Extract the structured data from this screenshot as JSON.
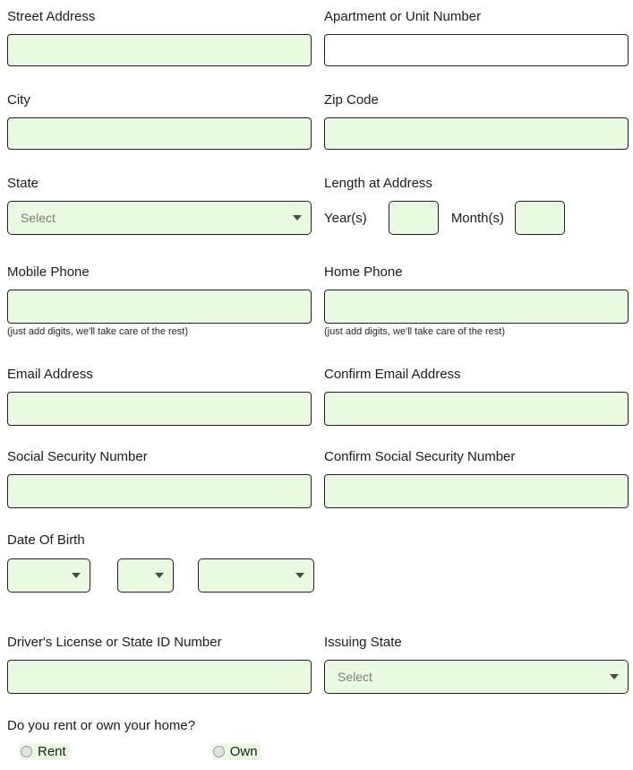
{
  "form": {
    "fields": {
      "street_address": {
        "label": "Street Address",
        "value": "",
        "required": true
      },
      "apartment": {
        "label": "Apartment or Unit Number",
        "value": "",
        "required": false
      },
      "city": {
        "label": "City",
        "value": "",
        "required": true
      },
      "zip_code": {
        "label": "Zip Code",
        "value": "",
        "required": true
      },
      "state": {
        "label": "State",
        "placeholder": "Select",
        "value": ""
      },
      "length_at_address": {
        "label": "Length at Address",
        "years_label": "Year(s)",
        "years_value": "",
        "months_label": "Month(s)",
        "months_value": ""
      },
      "mobile_phone": {
        "label": "Mobile Phone",
        "value": "",
        "helper": "(just add digits, we'll take care of the rest)"
      },
      "home_phone": {
        "label": "Home Phone",
        "value": "",
        "helper": "(just add digits, we'll take care of the rest)"
      },
      "email": {
        "label": "Email Address",
        "value": ""
      },
      "confirm_email": {
        "label": "Confirm Email Address",
        "value": ""
      },
      "ssn": {
        "label": "Social Security Number",
        "value": ""
      },
      "confirm_ssn": {
        "label": "Confirm Social Security Number",
        "value": ""
      },
      "date_of_birth": {
        "label": "Date Of Birth",
        "month_value": "",
        "day_value": "",
        "year_value": ""
      },
      "drivers_license": {
        "label": "Driver's License or State ID Number",
        "value": ""
      },
      "issuing_state": {
        "label": "Issuing State",
        "placeholder": "Select",
        "value": ""
      },
      "home_ownership": {
        "label": "Do you rent or own your home?",
        "options": [
          {
            "label": "Rent",
            "selected": false
          },
          {
            "label": "Own",
            "selected": false
          }
        ]
      }
    },
    "colors": {
      "required_field_bg": "#eafae1",
      "optional_field_bg": "#ffffff",
      "border": "#222222",
      "label_text": "#1c1c1c",
      "placeholder_text": "#7d7d7d",
      "page_bg": "#ffffff"
    }
  }
}
